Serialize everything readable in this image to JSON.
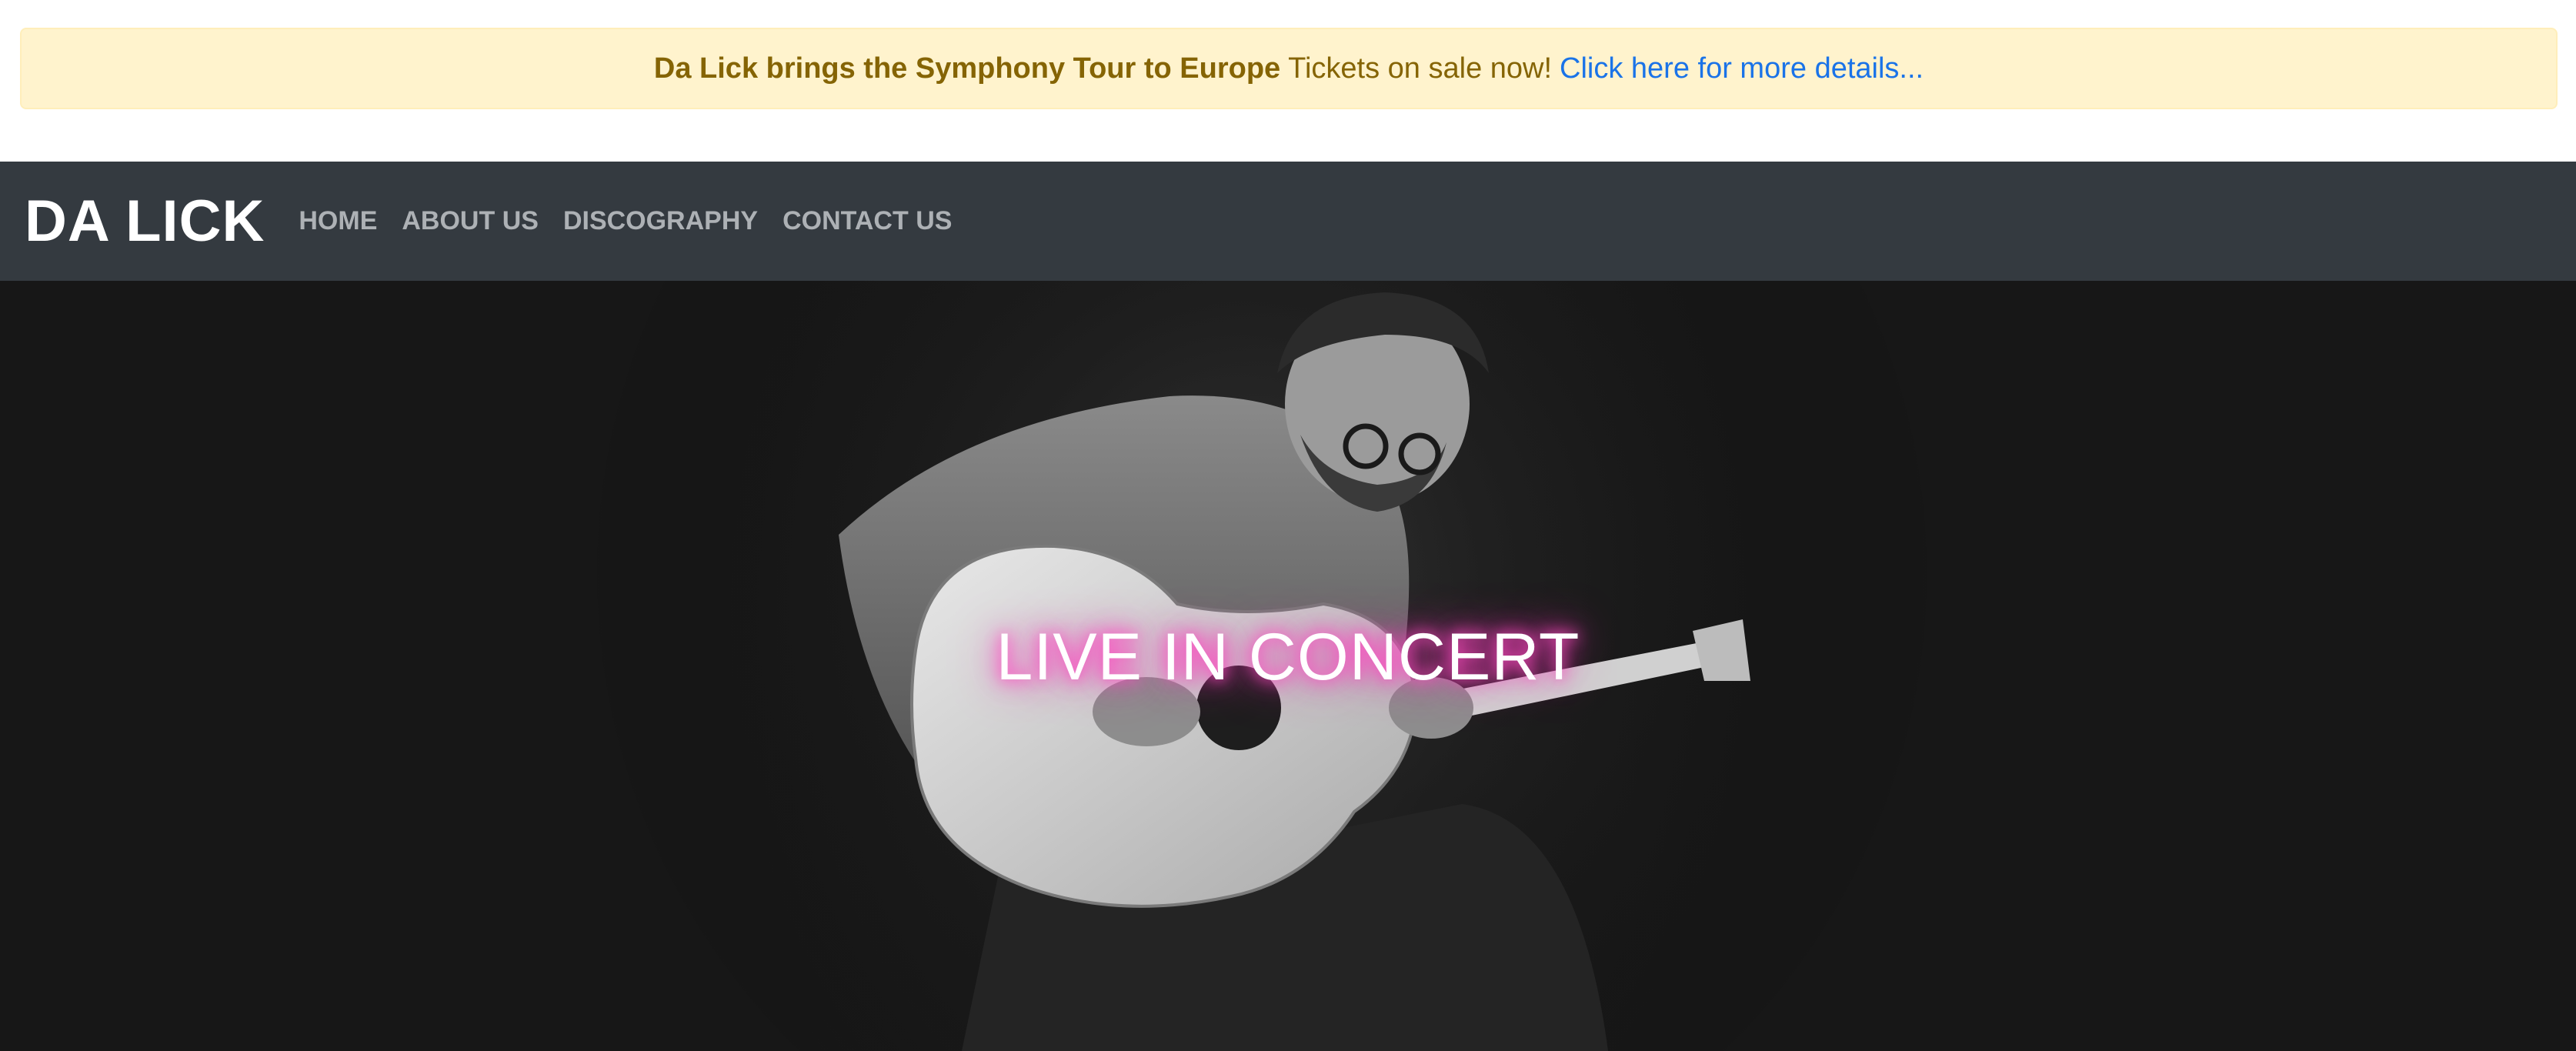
{
  "alert": {
    "headline": "Da Lick brings the Symphony Tour to Europe",
    "message": "Tickets on sale now!",
    "link_text": "Click here for more details..."
  },
  "navbar": {
    "brand": "DA LICK",
    "items": [
      {
        "label": "HOME"
      },
      {
        "label": "ABOUT US"
      },
      {
        "label": "DISCOGRAPHY"
      },
      {
        "label": "CONTACT US"
      }
    ]
  },
  "hero": {
    "title": "LIVE IN CONCERT",
    "image": "guitarist-photo"
  },
  "colors": {
    "alert_bg": "#fff3cd",
    "alert_text": "#856404",
    "link": "#1a73e8",
    "navbar_bg": "#343a40",
    "nav_text": "#adb1b5",
    "glow": "#ff3bbf"
  }
}
